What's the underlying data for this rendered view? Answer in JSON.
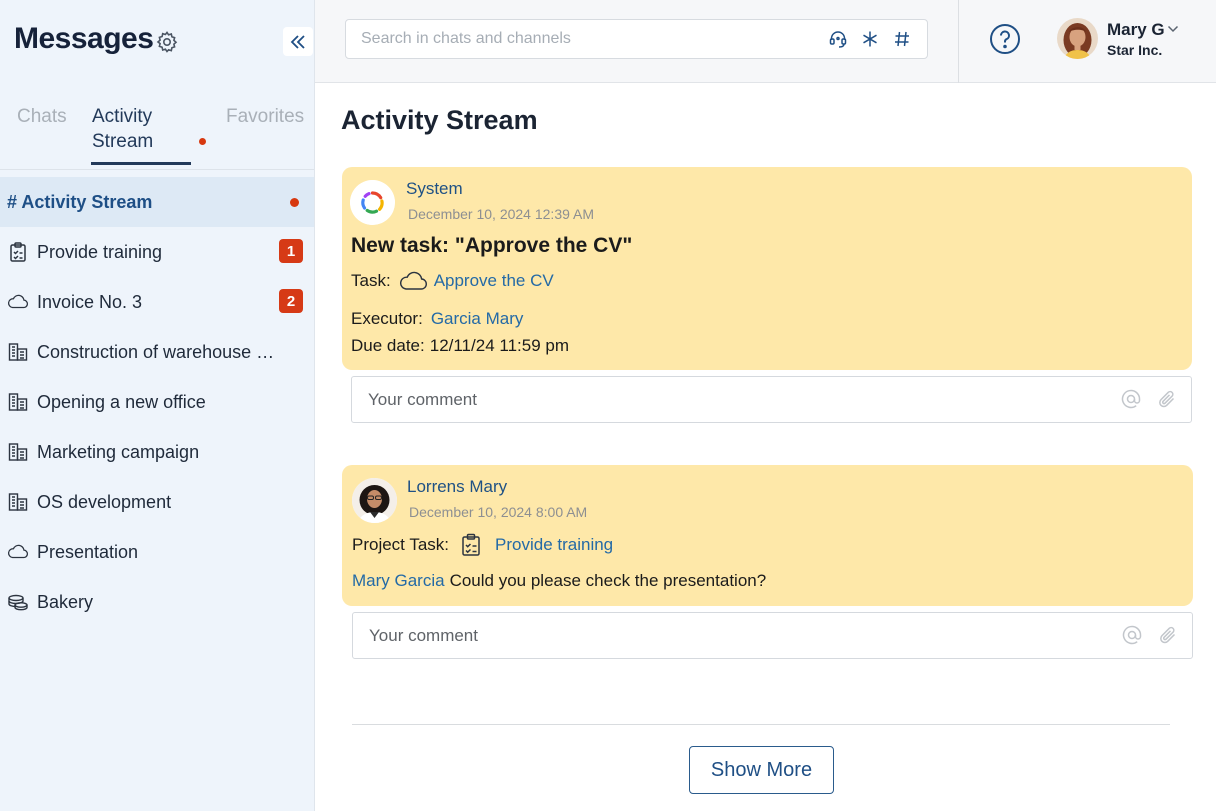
{
  "sidebar": {
    "title": "Messages",
    "tabs": [
      {
        "label": "Chats"
      },
      {
        "label": "Activity Stream"
      },
      {
        "label": "Favorites"
      }
    ],
    "items": [
      {
        "label": "# Activity Stream",
        "icon": "hash-icon",
        "selected": true,
        "dot": true
      },
      {
        "label": "Provide training",
        "icon": "clipboard-task-icon",
        "badge": "1"
      },
      {
        "label": "Invoice No. 3",
        "icon": "cloud-icon",
        "badge": "2"
      },
      {
        "label": "Construction of warehouse N...",
        "icon": "building-icon"
      },
      {
        "label": "Opening a new office",
        "icon": "building-icon"
      },
      {
        "label": "Marketing campaign",
        "icon": "building-icon"
      },
      {
        "label": "OS development",
        "icon": "building-icon"
      },
      {
        "label": "Presentation",
        "icon": "cloud-icon"
      },
      {
        "label": "Bakery",
        "icon": "coins-icon"
      }
    ]
  },
  "header": {
    "search_placeholder": "Search in chats and channels",
    "user_name": "Mary G",
    "user_company": "Star Inc."
  },
  "main": {
    "title": "Activity Stream",
    "posts": [
      {
        "author": "System",
        "date": "December 10, 2024 12:39 AM",
        "title": "New task: \"Approve the CV\"",
        "task_label": "Task:",
        "task_link": "Approve the CV",
        "executor_label": "Executor:",
        "executor": "Garcia Mary",
        "due_label": "Due date:",
        "due": "12/11/24 11:59 pm"
      },
      {
        "author": "Lorrens Mary",
        "date": "December 10, 2024 8:00 AM",
        "project_label": "Project Task:",
        "project_link": "Provide training",
        "mention": "Mary Garcia",
        "message": "Could you please check the presentation?"
      }
    ],
    "comment_placeholder": "Your comment",
    "show_more": "Show More"
  },
  "colors": {
    "accent": "#1f5185",
    "card": "#fee8a9",
    "badge": "#d63a16",
    "sidebar_bg": "#eef4fb"
  }
}
